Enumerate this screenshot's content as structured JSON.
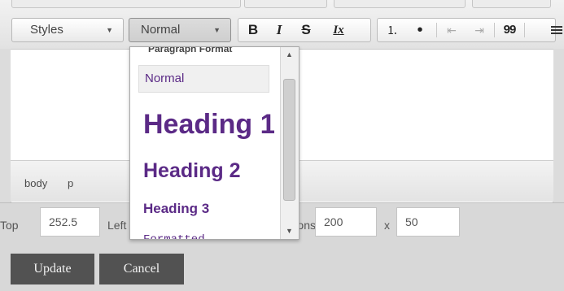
{
  "toolbar": {
    "styles_label": "Styles",
    "format_label": "Normal",
    "combo_arrow": "▼",
    "buttons": {
      "bold": "B",
      "italic": "I",
      "strike": "S",
      "remove_format": "Ix",
      "numbered_list": "⒈",
      "bulleted_list": "•",
      "outdent": "⇤",
      "indent": "⇥",
      "blockquote": "99"
    }
  },
  "format_dropdown": {
    "title": "Paragraph Format",
    "items": [
      {
        "label": "Normal"
      },
      {
        "label": "Heading 1"
      },
      {
        "label": "Heading 2"
      },
      {
        "label": "Heading 3"
      },
      {
        "label": "Formatted"
      }
    ],
    "accent_color": "#5b2a86"
  },
  "path_bar": {
    "elements": [
      "body",
      "p"
    ]
  },
  "position_form": {
    "top_label": "Top",
    "top_value": "252.5",
    "left_label": "Left",
    "dims_label": "Dimensions",
    "width_value": "200",
    "x_label": "x",
    "height_value": "50"
  },
  "actions": {
    "update_label": "Update",
    "cancel_label": "Cancel"
  }
}
